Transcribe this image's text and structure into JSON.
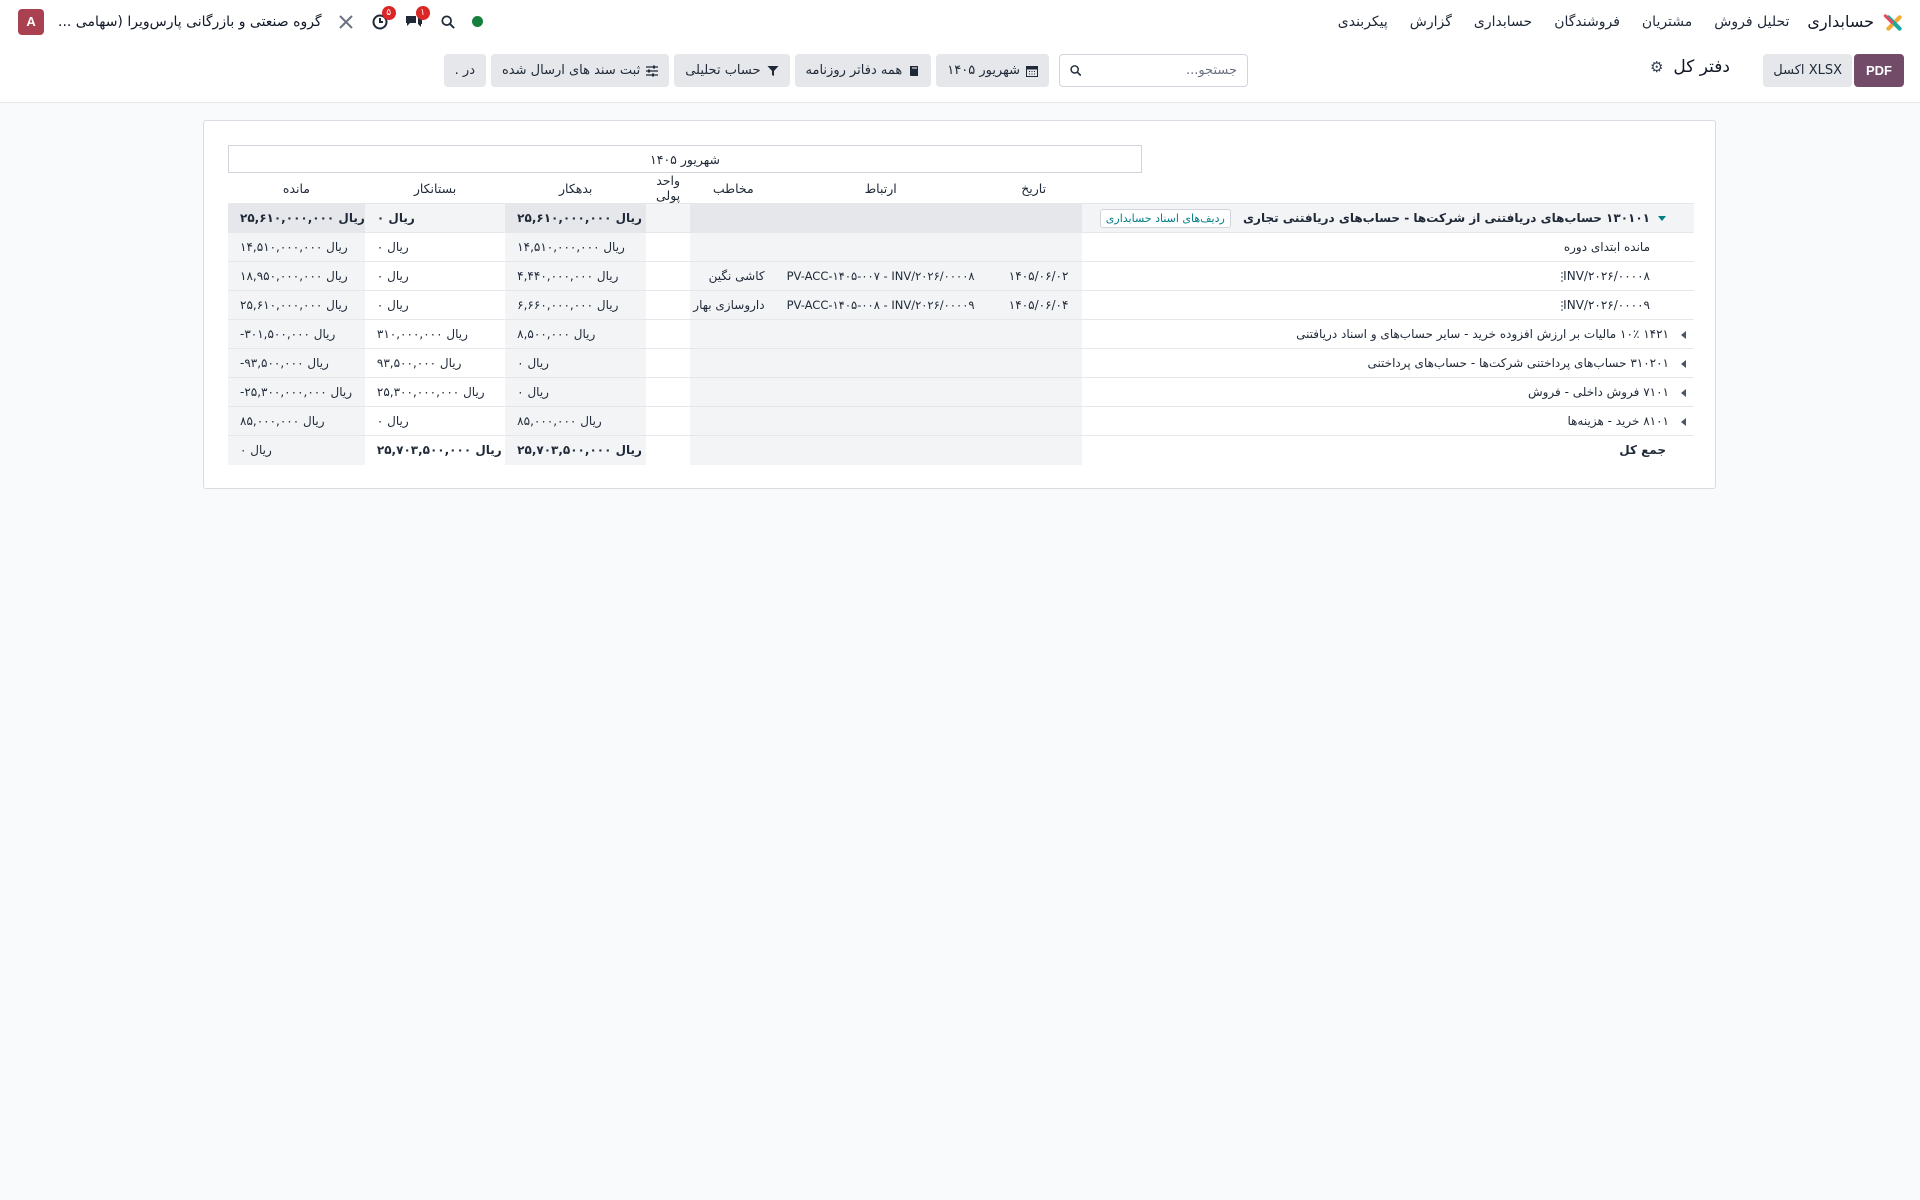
{
  "navbar": {
    "brand": "حسابداری",
    "menu": [
      "تحلیل فروش",
      "مشتریان",
      "فروشندگان",
      "حسابداری",
      "گزارش",
      "پیکربندی"
    ],
    "activity_badge": "۵",
    "messages_badge": "۱",
    "company": "گروه صنعتی و بازرگانی پارس‌ویرا (سهامی ...",
    "avatar_letter": "A"
  },
  "control": {
    "pdf_label": "PDF",
    "xlsx_label": "XLSX اکسل",
    "title": "دفتر کل",
    "search_placeholder": "جستجو...",
    "filters": [
      {
        "label": "شهریور ۱۴۰۵",
        "icon": "calendar-icon"
      },
      {
        "label": "همه دفاتر روزنامه",
        "icon": "book-icon"
      },
      {
        "label": "حساب تحلیلی",
        "icon": "filter-icon"
      },
      {
        "label": "ثبت سند های ارسال شده",
        "icon": "sliders-icon"
      },
      {
        "label": "در .",
        "icon": ""
      }
    ]
  },
  "report": {
    "period": "شهریور ۱۴۰۵",
    "columns": {
      "date": "تاریخ",
      "communication": "ارتباط",
      "partner": "مخاطب",
      "currency": "واحد پولی",
      "debit": "بدهکار",
      "credit": "بستانکار",
      "balance": "مانده"
    },
    "account_head": {
      "label": "۱۳۰۱۰۱ حساب‌های دریافتنی از شرکت‌ها - حساب‌های دریافتنی تجاری",
      "tag": "ردیف‌های اسناد حسابداری",
      "debit": "۲۵,۶۱۰,۰۰۰,۰۰۰ ریال",
      "credit": "۰ ریال",
      "balance": "۲۵,۶۱۰,۰۰۰,۰۰۰ ریال"
    },
    "initial": {
      "label": "مانده ابتدای دوره",
      "debit": "۱۴,۵۱۰,۰۰۰,۰۰۰ ریال",
      "credit": "۰ ریال",
      "balance": "۱۴,۵۱۰,۰۰۰,۰۰۰ ریال"
    },
    "lines": [
      {
        "label": "INV/۲۰۲۶/۰۰۰۰۸",
        "date": "۱۴۰۵/۰۶/۰۲",
        "communication": "PV-ACC-۱۴۰۵-۰۰۷ - INV/۲۰۲۶/۰۰۰۰۸",
        "partner": "کاشی نگین",
        "debit": "۴,۴۴۰,۰۰۰,۰۰۰ ریال",
        "credit": "۰ ریال",
        "balance": "۱۸,۹۵۰,۰۰۰,۰۰۰ ریال"
      },
      {
        "label": "INV/۲۰۲۶/۰۰۰۰۹",
        "date": "۱۴۰۵/۰۶/۰۴",
        "communication": "PV-ACC-۱۴۰۵-۰۰۸ - INV/۲۰۲۶/۰۰۰۰۹",
        "partner": "داروسازی بهار",
        "debit": "۶,۶۶۰,۰۰۰,۰۰۰ ریال",
        "credit": "۰ ریال",
        "balance": "۲۵,۶۱۰,۰۰۰,۰۰۰ ریال"
      }
    ],
    "accounts": [
      {
        "label": "۱۴۲۱ ۱۰٪ مالیات بر ارزش افزوده خرید - سایر حساب‌های و اسناد دریافتنی",
        "debit": "۸,۵۰۰,۰۰۰ ریال",
        "credit": "۳۱۰,۰۰۰,۰۰۰ ریال",
        "balance": "-۳۰۱,۵۰۰,۰۰۰ ریال",
        "debit_zero": false,
        "credit_zero": false,
        "negative": true
      },
      {
        "label": "۳۱۰۲۰۱ حساب‌های پرداختنی شرکت‌ها - حساب‌های پرداختنی",
        "debit": "۰ ریال",
        "credit": "۹۳,۵۰۰,۰۰۰ ریال",
        "balance": "-۹۳,۵۰۰,۰۰۰ ریال",
        "debit_zero": true,
        "credit_zero": false,
        "negative": true
      },
      {
        "label": "۷۱۰۱ فروش داخلی - فروش",
        "debit": "۰ ریال",
        "credit": "۲۵,۳۰۰,۰۰۰,۰۰۰ ریال",
        "balance": "-۲۵,۳۰۰,۰۰۰,۰۰۰ ریال",
        "debit_zero": true,
        "credit_zero": false,
        "negative": true
      },
      {
        "label": "۸۱۰۱ خرید - هزینه‌ها",
        "debit": "۸۵,۰۰۰,۰۰۰ ریال",
        "credit": "۰ ریال",
        "balance": "۸۵,۰۰۰,۰۰۰ ریال",
        "debit_zero": false,
        "credit_zero": true,
        "negative": false
      }
    ],
    "total": {
      "label": "جمع کل",
      "debit": "۲۵,۷۰۳,۵۰۰,۰۰۰ ریال",
      "credit": "۲۵,۷۰۳,۵۰۰,۰۰۰ ریال",
      "balance": "۰ ریال"
    }
  },
  "colors": {
    "brand_purple": "#714b67",
    "accent_teal": "#017e84",
    "negative_red": "#b91c1c",
    "presence_green": "#15803d"
  }
}
